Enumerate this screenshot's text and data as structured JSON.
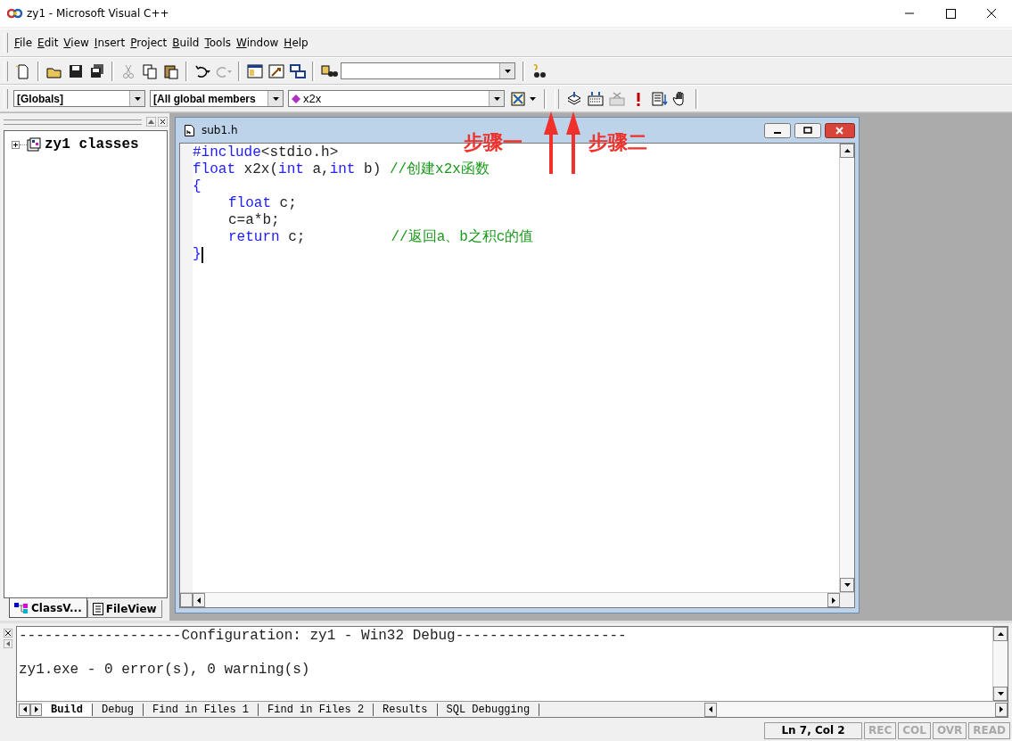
{
  "window": {
    "title": "zy1 - Microsoft Visual C++"
  },
  "menu": [
    {
      "key": "F",
      "rest": "ile"
    },
    {
      "key": "E",
      "rest": "dit"
    },
    {
      "key": "V",
      "rest": "iew"
    },
    {
      "key": "I",
      "rest": "nsert"
    },
    {
      "key": "P",
      "rest": "roject"
    },
    {
      "key": "B",
      "rest": "uild"
    },
    {
      "key": "T",
      "rest": "ools"
    },
    {
      "key": "W",
      "rest": "indow"
    },
    {
      "key": "H",
      "rest": "elp"
    }
  ],
  "wizard_bar": {
    "scope": "[Globals]",
    "filter": "[All global members",
    "member": "x2x"
  },
  "class_view": {
    "tree": [
      {
        "label": "zy1 classes",
        "expanded": false
      }
    ],
    "tabs": [
      {
        "label": "ClassV...",
        "selected": true
      },
      {
        "label": "FileView",
        "selected": false
      }
    ]
  },
  "editor": {
    "title": "sub1.h",
    "lines": [
      {
        "indent": false,
        "caret": false,
        "segs": [
          {
            "kind": "keyword",
            "t": "#include"
          },
          {
            "kind": "plain",
            "t": "<stdio.h>"
          }
        ]
      },
      {
        "indent": false,
        "caret": false,
        "segs": [
          {
            "kind": "keyword",
            "t": "float"
          },
          {
            "kind": "plain",
            "t": " x2x("
          },
          {
            "kind": "keyword",
            "t": "int"
          },
          {
            "kind": "plain",
            "t": " a,"
          },
          {
            "kind": "keyword",
            "t": "int"
          },
          {
            "kind": "plain",
            "t": " b) "
          },
          {
            "kind": "comment",
            "t": "//创建x2x函数"
          }
        ]
      },
      {
        "indent": false,
        "caret": false,
        "segs": [
          {
            "kind": "keyword",
            "t": "{"
          }
        ]
      },
      {
        "indent": true,
        "caret": false,
        "segs": [
          {
            "kind": "keyword",
            "t": "float"
          },
          {
            "kind": "plain",
            "t": " c;"
          }
        ]
      },
      {
        "indent": true,
        "caret": false,
        "segs": [
          {
            "kind": "plain",
            "t": "c=a*b;"
          }
        ]
      },
      {
        "indent": true,
        "caret": false,
        "segs": [
          {
            "kind": "keyword",
            "t": "return"
          },
          {
            "kind": "plain",
            "t": " c;          "
          },
          {
            "kind": "comment",
            "t": "//返回a、b之积c的值"
          }
        ]
      },
      {
        "indent": false,
        "caret": true,
        "segs": [
          {
            "kind": "keyword",
            "t": "}"
          }
        ]
      }
    ]
  },
  "annotations": [
    {
      "text": "步骤一"
    },
    {
      "text": "步骤二"
    }
  ],
  "output": {
    "lines": [
      "-------------------Configuration: zy1 - Win32 Debug--------------------",
      "zy1.exe - 0 error(s), 0 warning(s)"
    ],
    "tabs": [
      {
        "label": "Build",
        "selected": true
      },
      {
        "label": "Debug",
        "selected": false
      },
      {
        "label": "Find in Files 1",
        "selected": false
      },
      {
        "label": "Find in Files 2",
        "selected": false
      },
      {
        "label": "Results",
        "selected": false
      },
      {
        "label": "SQL Debugging",
        "selected": false
      }
    ]
  },
  "status_bar": {
    "position": "Ln 7, Col 2",
    "indicators": [
      {
        "label": "REC",
        "on": false
      },
      {
        "label": "COL",
        "on": false
      },
      {
        "label": "OVR",
        "on": false
      },
      {
        "label": "READ",
        "on": false
      }
    ]
  }
}
